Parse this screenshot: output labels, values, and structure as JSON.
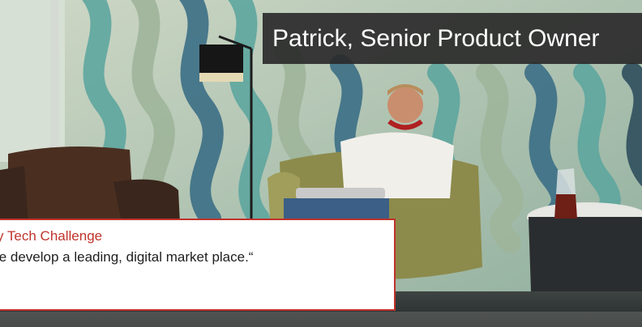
{
  "banner": {
    "name_title": "Patrick, Senior Product Owner"
  },
  "quote_card": {
    "title": "y Tech Challenge",
    "quote": "/e develop a leading, digital market place.“"
  },
  "colors": {
    "accent_red": "#c0322b",
    "banner_bg": "#2a2a2a",
    "wall_teal": "#5fa9a0",
    "wall_sage": "#a9b79b"
  },
  "icons": []
}
